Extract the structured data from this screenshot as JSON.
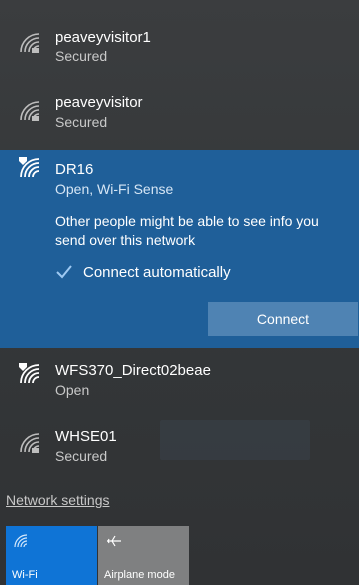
{
  "networks": [
    {
      "name": "peaveyvisitor1",
      "status": "Secured",
      "icon": "wifi-secured-icon"
    },
    {
      "name": "peaveyvisitor",
      "status": "Secured",
      "icon": "wifi-secured-icon"
    },
    {
      "name": "DR16",
      "status": "Open, Wi-Fi Sense",
      "icon": "wifi-open-shield-icon"
    },
    {
      "name": "WFS370_Direct02beae",
      "status": "Open",
      "icon": "wifi-open-shield-icon"
    },
    {
      "name": "WHSE01",
      "status": "Secured",
      "icon": "wifi-secured-icon"
    }
  ],
  "selected": {
    "warning": "Other people might be able to see info you send over this network",
    "connect_auto_label": "Connect automatically",
    "connect_auto_checked": true,
    "connect_button": "Connect"
  },
  "network_settings_link": "Network settings",
  "tiles": {
    "wifi": {
      "label": "Wi-Fi",
      "icon": "wifi-icon",
      "active": true
    },
    "airplane": {
      "label": "Airplane mode",
      "icon": "airplane-icon",
      "active": false
    }
  },
  "colors": {
    "accent": "#1f5f99",
    "button": "#4f83b3",
    "tile_active": "#0f74d6",
    "tile_inactive": "#7f8081"
  }
}
